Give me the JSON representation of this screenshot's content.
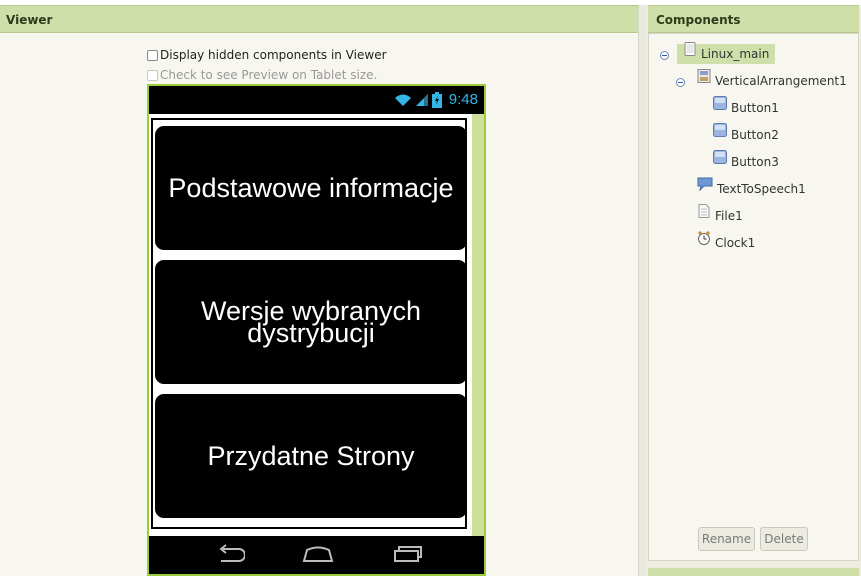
{
  "viewer": {
    "title": "Viewer",
    "show_hidden_label": "Display hidden components in Viewer",
    "tablet_preview_label": "Check to see Preview on Tablet size.",
    "phone": {
      "status_time": "9:48",
      "buttons": [
        {
          "text": "Podstawowe informacje"
        },
        {
          "text": "Wersje wybranych dystrybucji"
        },
        {
          "text": "Przydatne Strony"
        }
      ]
    }
  },
  "components": {
    "title": "Components",
    "tree": [
      {
        "label": "Linux_main",
        "icon": "screen-icon",
        "selected": true
      },
      {
        "label": "VerticalArrangement1",
        "icon": "vertical-arrangement-icon"
      },
      {
        "label": "Button1",
        "icon": "button-icon"
      },
      {
        "label": "Button2",
        "icon": "button-icon"
      },
      {
        "label": "Button3",
        "icon": "button-icon"
      },
      {
        "label": "TextToSpeech1",
        "icon": "text-to-speech-icon"
      },
      {
        "label": "File1",
        "icon": "file-icon"
      },
      {
        "label": "Clock1",
        "icon": "clock-icon"
      }
    ],
    "rename_label": "Rename",
    "delete_label": "Delete"
  },
  "colors": {
    "header_green": "#cfdfaa",
    "phone_border": "#9ccc3c",
    "status_time": "#34b5e5"
  }
}
